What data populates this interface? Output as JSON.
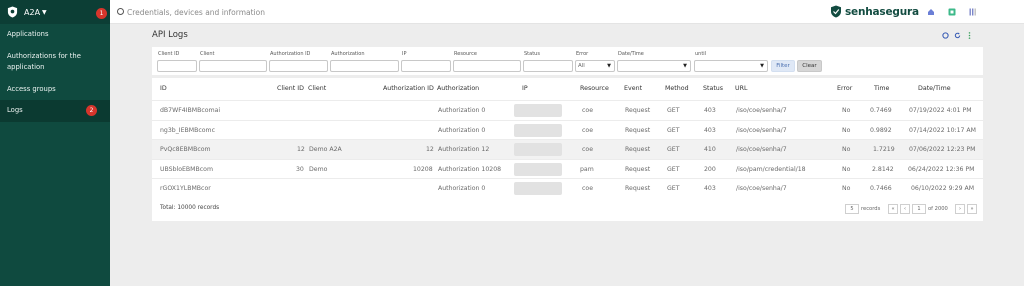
{
  "sidebar": {
    "title": "A2A",
    "badge_top": "1",
    "items": [
      {
        "label": "Applications"
      },
      {
        "label": "Authorizations for the"
      },
      {
        "label": "application"
      },
      {
        "label": "Access groups"
      },
      {
        "label": "Logs",
        "badge": "2"
      }
    ]
  },
  "topbar": {
    "search_placeholder": "Credentials, devices and information",
    "logo_text": "senhasegura"
  },
  "page": {
    "title": "API Logs"
  },
  "filters": {
    "labels": [
      "Client ID",
      "Client",
      "Authorization ID",
      "Authorization",
      "IP",
      "Resource",
      "Status",
      "Error",
      "Date/Time",
      "until"
    ],
    "error_value": "All",
    "filter_button": "Filter",
    "clear_button": "Clear"
  },
  "table": {
    "headers": [
      "ID",
      "Client ID",
      "Client",
      "Authorization ID",
      "Authorization",
      "IP",
      "Resource",
      "Event",
      "Method",
      "Status",
      "URL",
      "Error",
      "Time",
      "Date/Time"
    ],
    "rows": [
      {
        "id": "dB7WF4IBMBcomai",
        "client_id": "",
        "client": "",
        "auth_id": "",
        "authorization": "Authorization 0",
        "resource": "coe",
        "event": "Request",
        "method": "GET",
        "status": "403",
        "url": "/iso/coe/senha/7",
        "error": "No",
        "time": "0.7469",
        "datetime": "07/19/2022 4:01 PM"
      },
      {
        "id": "ng3b_IEBMBcomc",
        "client_id": "",
        "client": "",
        "auth_id": "",
        "authorization": "Authorization 0",
        "resource": "coe",
        "event": "Request",
        "method": "GET",
        "status": "403",
        "url": "/iso/coe/senha/7",
        "error": "No",
        "time": "0.9892",
        "datetime": "07/14/2022 10:17 AM"
      },
      {
        "id": "PvQc8EBMBcom",
        "client_id": "12",
        "client": "Demo A2A",
        "auth_id": "12",
        "authorization": "Authorization 12",
        "resource": "coe",
        "event": "Request",
        "method": "GET",
        "status": "410",
        "url": "/iso/coe/senha/7",
        "error": "No",
        "time": "1.7219",
        "datetime": "07/06/2022 12:23 PM"
      },
      {
        "id": "UBSbloEBMBcom",
        "client_id": "30",
        "client": "Demo",
        "auth_id": "10208",
        "authorization": "Authorization 10208",
        "resource": "pam",
        "event": "Request",
        "method": "GET",
        "status": "200",
        "url": "/iso/pam/credential/18",
        "error": "No",
        "time": "2.8142",
        "datetime": "06/24/2022 12:36 PM"
      },
      {
        "id": "rGOX1YLBMBcor",
        "client_id": "",
        "client": "",
        "auth_id": "",
        "authorization": "Authorization 0",
        "resource": "coe",
        "event": "Request",
        "method": "GET",
        "status": "403",
        "url": "/iso/coe/senha/7",
        "error": "No",
        "time": "0.7466",
        "datetime": "06/10/2022 9:29 AM"
      }
    ],
    "total": "Total: 10000 records"
  },
  "pagination": {
    "records_value": "5",
    "records_label": "records",
    "page_value": "1",
    "of_label": "of 2000",
    "first": "«",
    "prev": "‹",
    "next": "›",
    "last": "»"
  },
  "colors": {
    "sidebar_bg": "#0f4a3f",
    "brand": "#124b40",
    "badge": "#d6352c"
  }
}
